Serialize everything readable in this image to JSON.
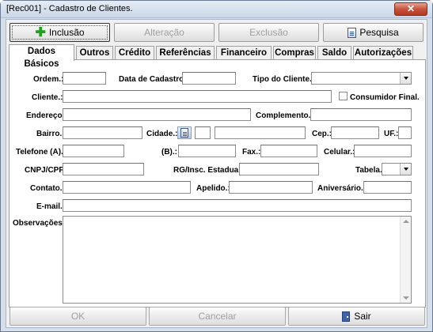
{
  "window": {
    "title": "[Rec001] - Cadastro de Clientes.",
    "close_label": "✕"
  },
  "toolbar": {
    "inclusao": "Inclusão",
    "alteracao": "Alteração",
    "exclusao": "Exclusão",
    "pesquisa": "Pesquisa"
  },
  "tabs": [
    "Dados Básicos",
    "Outros",
    "Crédito",
    "Referências",
    "Financeiro",
    "Compras",
    "Saldo",
    "Autorizações"
  ],
  "form": {
    "ordem": "Ordem.:",
    "data_cadastro": "Data de Cadastro.:",
    "tipo_cliente": "Tipo do Cliente.:",
    "cliente": "Cliente.:",
    "consumidor_final": "Consumidor Final.",
    "endereco": "Endereço.:",
    "complemento": "Complemento.:",
    "bairro": "Bairro.:",
    "cidade": "Cidade.:",
    "cep": "Cep.:",
    "uf": "UF.:",
    "telefone_a": "Telefone (A).:",
    "telefone_b": "(B).:",
    "fax": "Fax.:",
    "celular": "Celular.:",
    "cnpj_cpf": "CNPJ/CPF.:",
    "rg_insc": "RG/Insc. Estadual.:",
    "tabela": "Tabela.:",
    "contato": "Contato.:",
    "apelido": "Apelido.:",
    "aniversario": "Aniversário.:",
    "email": "E-mail.:",
    "observacoes": "Observações.:"
  },
  "bottom": {
    "ok": "OK",
    "cancelar": "Cancelar",
    "sair": "Sair"
  }
}
